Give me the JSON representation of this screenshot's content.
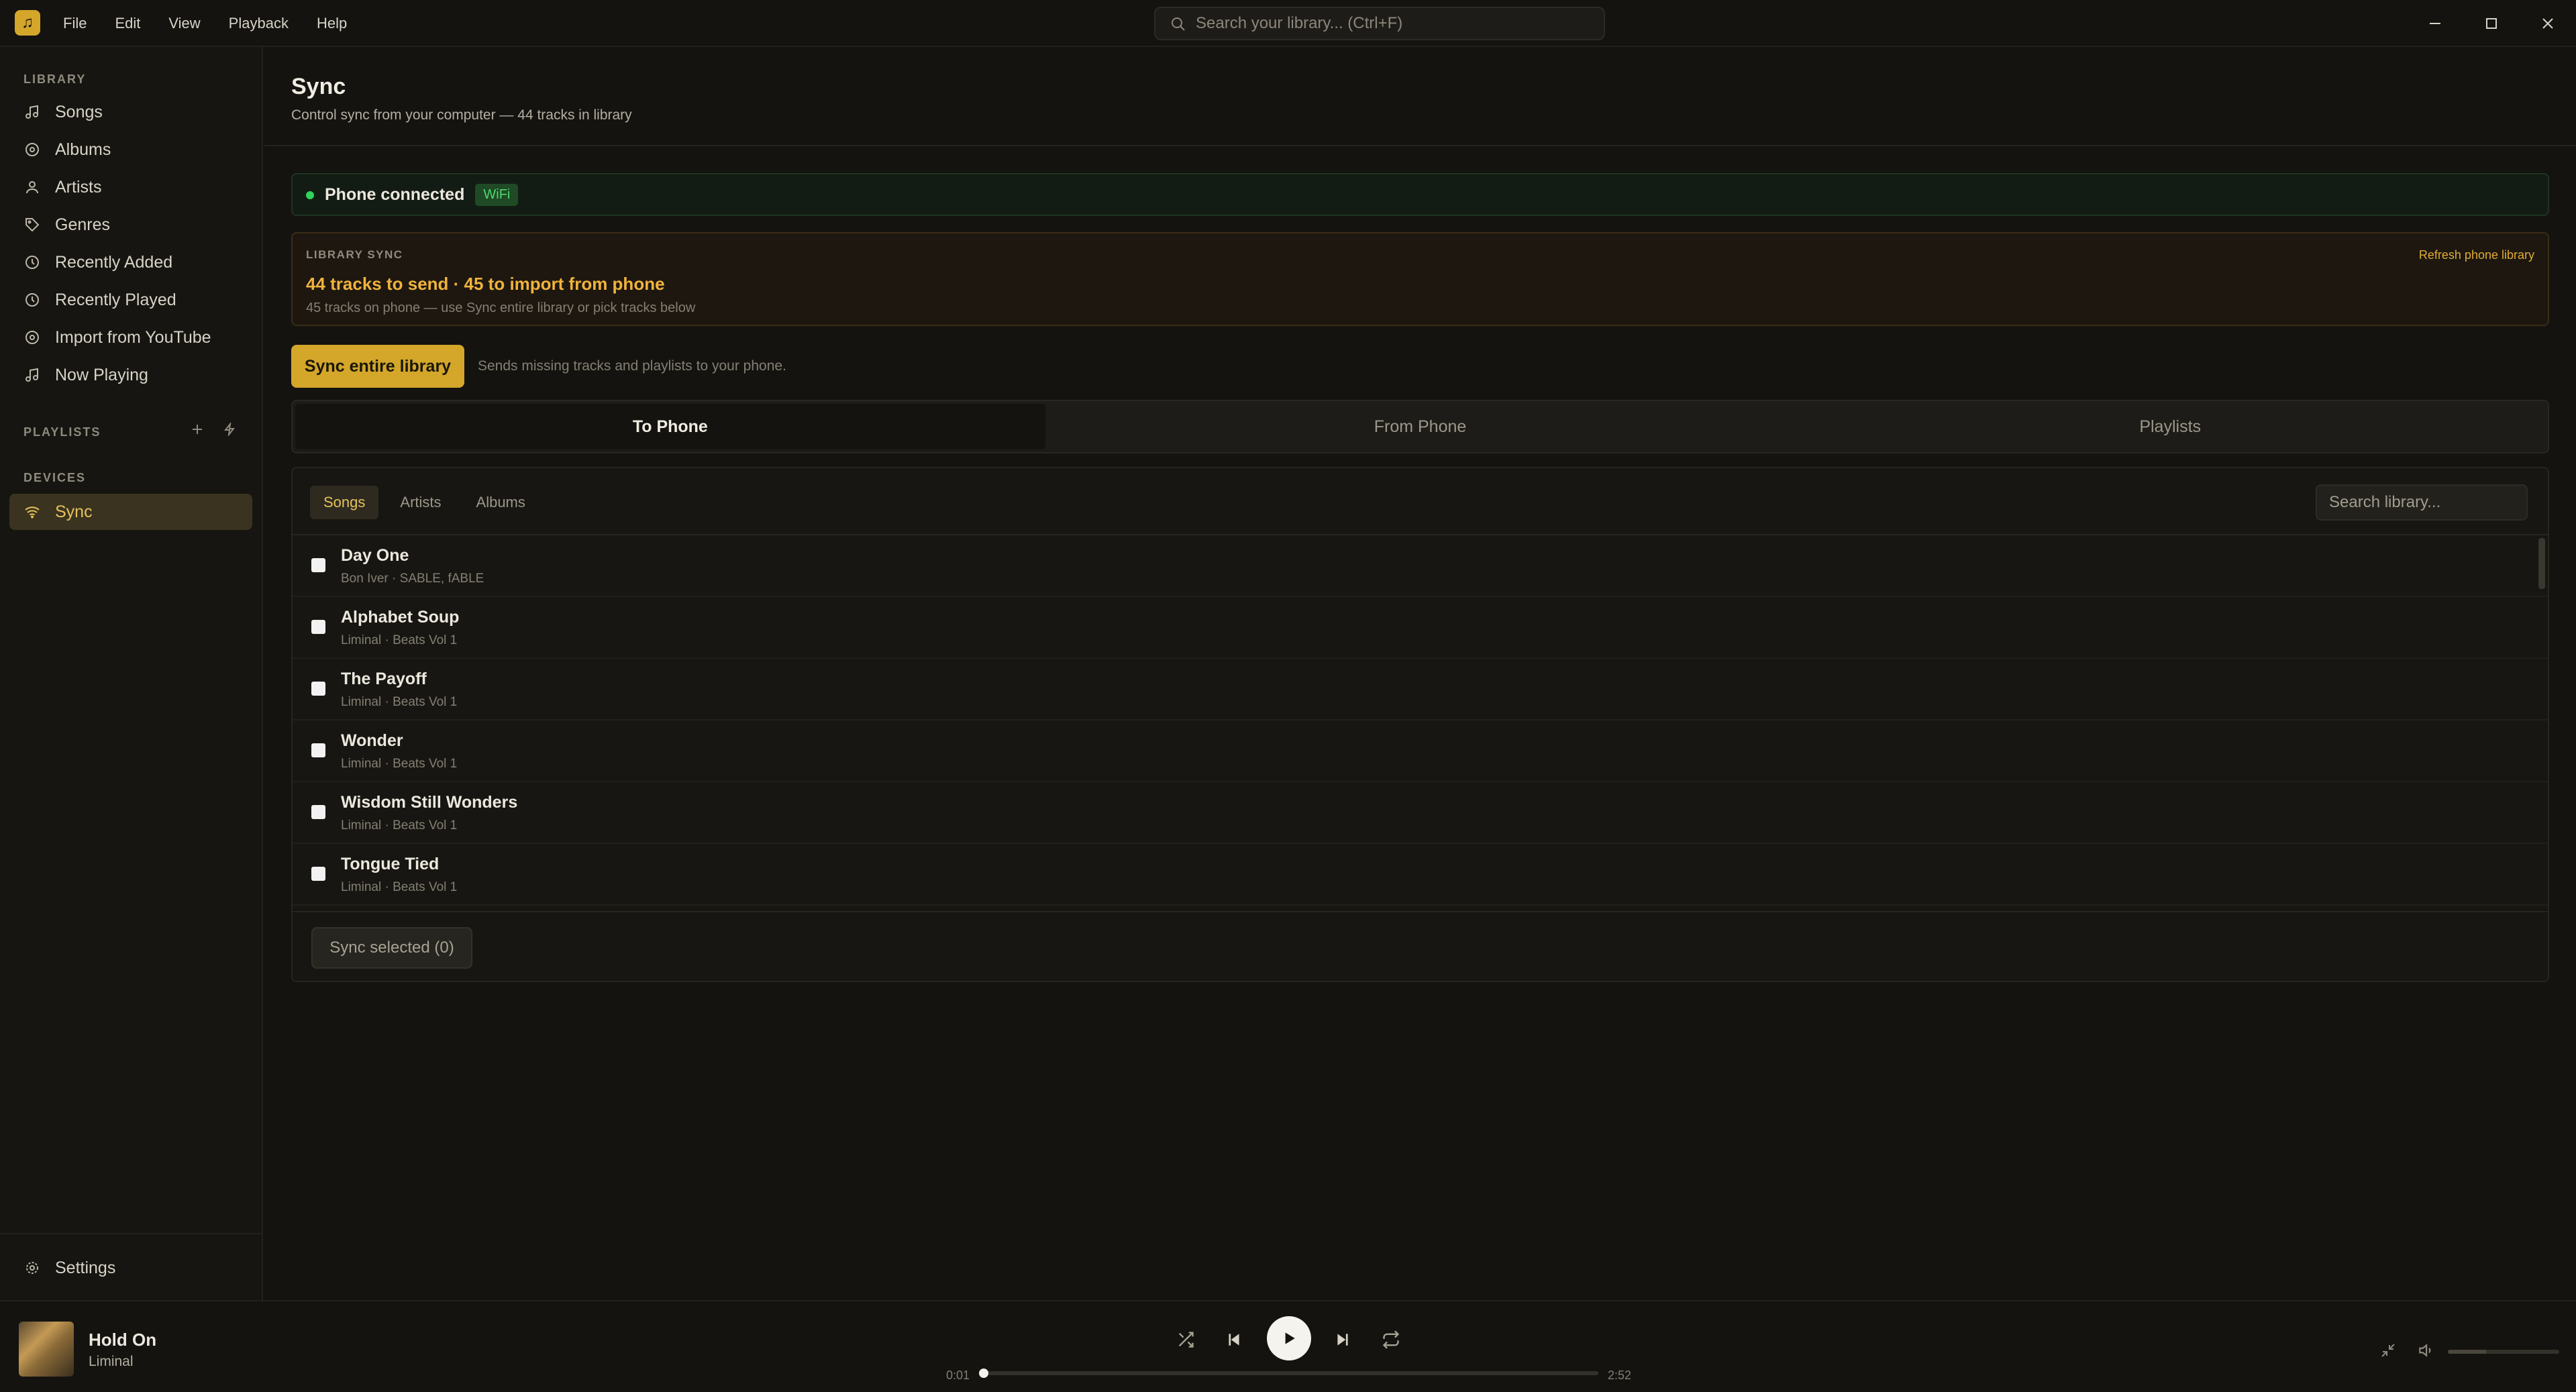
{
  "app": {
    "logo_glyph": "♫",
    "accent": "#d4a62a"
  },
  "menu": [
    "File",
    "Edit",
    "View",
    "Playback",
    "Help"
  ],
  "top_search": {
    "placeholder": "Search your library... (Ctrl+F)"
  },
  "sidebar": {
    "library_label": "LIBRARY",
    "items": [
      {
        "label": "Songs",
        "icon": "music-note-icon"
      },
      {
        "label": "Albums",
        "icon": "disc-icon"
      },
      {
        "label": "Artists",
        "icon": "person-icon"
      },
      {
        "label": "Genres",
        "icon": "tag-icon"
      },
      {
        "label": "Recently Added",
        "icon": "clock-icon"
      },
      {
        "label": "Recently Played",
        "icon": "clock-icon"
      },
      {
        "label": "Import from YouTube",
        "icon": "disc-icon"
      },
      {
        "label": "Now Playing",
        "icon": "music-note-icon"
      }
    ],
    "playlists_label": "PLAYLISTS",
    "devices_label": "DEVICES",
    "sync_label": "Sync",
    "settings_label": "Settings"
  },
  "page": {
    "title": "Sync",
    "subtitle": "Control sync from your computer — 44 tracks in library"
  },
  "connection": {
    "status": "Phone connected",
    "badge": "WiFi",
    "status_color": "#2fd35b"
  },
  "library_sync": {
    "label": "LIBRARY SYNC",
    "headline": "44 tracks to send · 45 to import from phone",
    "detail": "45 tracks on phone — use Sync entire library or pick tracks below",
    "refresh_label": "Refresh phone library"
  },
  "sync_all": {
    "label": "Sync entire library",
    "hint": "Sends missing tracks and playlists to your phone."
  },
  "tabs": [
    "To Phone",
    "From Phone",
    "Playlists"
  ],
  "subtabs": [
    "Songs",
    "Artists",
    "Albums"
  ],
  "list_search": {
    "placeholder": "Search library..."
  },
  "tracks": [
    {
      "title": "Day One",
      "sub": "Bon Iver · SABLE, fABLE"
    },
    {
      "title": "Alphabet Soup",
      "sub": "Liminal · Beats Vol 1"
    },
    {
      "title": "The Payoff",
      "sub": "Liminal · Beats Vol 1"
    },
    {
      "title": "Wonder",
      "sub": "Liminal · Beats Vol 1"
    },
    {
      "title": "Wisdom Still Wonders",
      "sub": "Liminal · Beats Vol 1"
    },
    {
      "title": "Tongue Tied",
      "sub": "Liminal · Beats Vol 1"
    }
  ],
  "sync_selected": {
    "label": "Sync selected (0)"
  },
  "player": {
    "title": "Hold On",
    "artist": "Liminal",
    "current_time": "0:01",
    "total_time": "2:52",
    "progress": 0.006,
    "volume": 0.35
  }
}
